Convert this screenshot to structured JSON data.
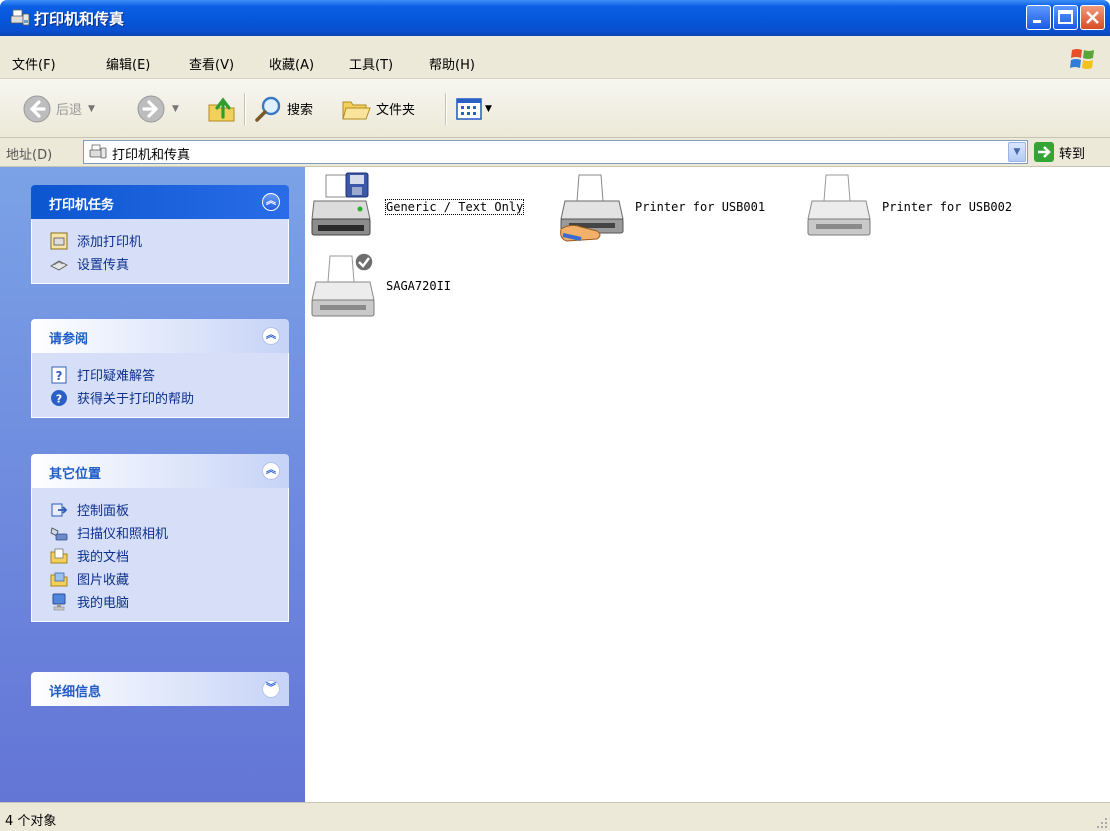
{
  "window": {
    "title": "打印机和传真"
  },
  "menu": [
    "文件(F)",
    "编辑(E)",
    "查看(V)",
    "收藏(A)",
    "工具(T)",
    "帮助(H)"
  ],
  "toolbar": {
    "back": "后退",
    "search": "搜索",
    "folders": "文件夹"
  },
  "address": {
    "label": "地址(D)",
    "value": "打印机和传真",
    "go": "转到"
  },
  "panels": [
    {
      "title": "打印机任务",
      "state": "expanded",
      "items": [
        "添加打印机",
        "设置传真"
      ]
    },
    {
      "title": "请参阅",
      "state": "expanded",
      "items": [
        "打印疑难解答",
        "获得关于打印的帮助"
      ]
    },
    {
      "title": "其它位置",
      "state": "expanded",
      "items": [
        "控制面板",
        "扫描仪和照相机",
        "我的文档",
        "图片收藏",
        "我的电脑"
      ]
    },
    {
      "title": "详细信息",
      "state": "collapsed",
      "items": []
    }
  ],
  "printers": [
    {
      "name": "Generic / Text Only",
      "icon": "printer-with-disk-icon"
    },
    {
      "name": "Printer for USB001",
      "icon": "shared-printer-icon"
    },
    {
      "name": "Printer for USB002",
      "icon": "printer-icon"
    },
    {
      "name": "SAGA720II",
      "icon": "default-printer-icon"
    }
  ],
  "status": {
    "text": "4 个对象"
  },
  "colors": {
    "title_bar": "#0556da",
    "task_pane": "#7ba2e7",
    "chrome": "#ece9d8"
  }
}
